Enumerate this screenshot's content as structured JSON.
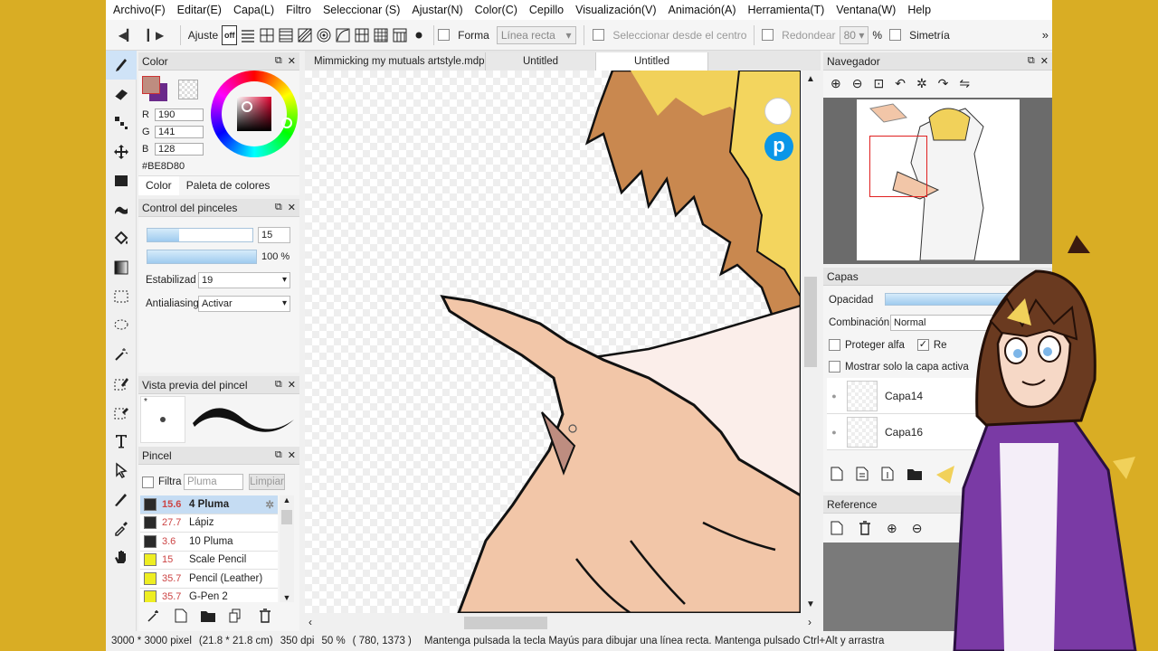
{
  "menu": [
    "Archivo(F)",
    "Editar(E)",
    "Capa(L)",
    "Filtro",
    "Seleccionar (S)",
    "Ajustar(N)",
    "Color(C)",
    "Cepillo",
    "Visualización(V)",
    "Animación(A)",
    "Herramienta(T)",
    "Ventana(W)",
    "Help"
  ],
  "toolbar": {
    "ajuste": "Ajuste",
    "off": "off",
    "forma": "Forma",
    "forma_value": "Línea recta",
    "seleccionar_centro": "Seleccionar desde el centro",
    "redondear": "Redondear",
    "redondear_value": "80",
    "percent": "%",
    "simetria": "Simetría",
    "more": "»"
  },
  "color_panel": {
    "title": "Color",
    "r_label": "R",
    "r": "190",
    "g_label": "G",
    "g": "141",
    "b_label": "B",
    "b": "128",
    "hex": "#BE8D80",
    "tab_color": "Color",
    "tab_palette": "Paleta de colores",
    "primary": "#be8d80",
    "secondary": "#6a2a8a"
  },
  "brush_control": {
    "title": "Control del pinceles",
    "size": "15",
    "opacity": "100 %",
    "size_fraction": 0.3,
    "opacity_fraction": 1.0,
    "estabilizad_label": "Estabilizad",
    "estabilizad_value": "19",
    "antialias_label": "Antialiasing",
    "antialias_value": "Activar"
  },
  "brush_preview": {
    "title": "Vista previa del pincel",
    "dot": "*"
  },
  "brush_list": {
    "title": "Pincel",
    "filter_label": "Filtrar",
    "filter_placeholder": "Pluma",
    "clear": "Limpiar",
    "items": [
      {
        "size": "15.6",
        "name": "4 Pluma",
        "color": "#2a2a2a",
        "selected": true
      },
      {
        "size": "27.7",
        "name": "Lápiz",
        "color": "#2a2a2a"
      },
      {
        "size": "3.6",
        "name": "10 Pluma",
        "color": "#2a2a2a"
      },
      {
        "size": "15",
        "name": "Scale Pencil",
        "color": "#eeee22"
      },
      {
        "size": "35.7",
        "name": "Pencil (Leather)",
        "color": "#eeee22"
      },
      {
        "size": "35.7",
        "name": "G-Pen 2",
        "color": "#eeee22"
      }
    ]
  },
  "tabs": [
    "Mimmicking my mutuals artstyle.mdp",
    "Untitled",
    "Untitled"
  ],
  "navigator": {
    "title": "Navegador"
  },
  "layers": {
    "title": "Capas",
    "opacity_label": "Opacidad",
    "blend_label": "Combinación",
    "blend_value": "Normal",
    "protect_alpha": "Proteger alfa",
    "re": "Re",
    "show_only": "Mostrar solo la capa activa",
    "items": [
      "Capa14",
      "Capa16"
    ]
  },
  "reference": {
    "title": "Reference"
  },
  "status": {
    "dims": "3000 * 3000 pixel",
    "cm": "(21.8 * 21.8 cm)",
    "dpi": "350 dpi",
    "zoom": "50 %",
    "coords": "( 780, 1373 )",
    "hint": "Mantenga pulsada la tecla Mayús para dibujar una línea recta. Mantenga pulsado Ctrl+Alt y arrastra"
  }
}
